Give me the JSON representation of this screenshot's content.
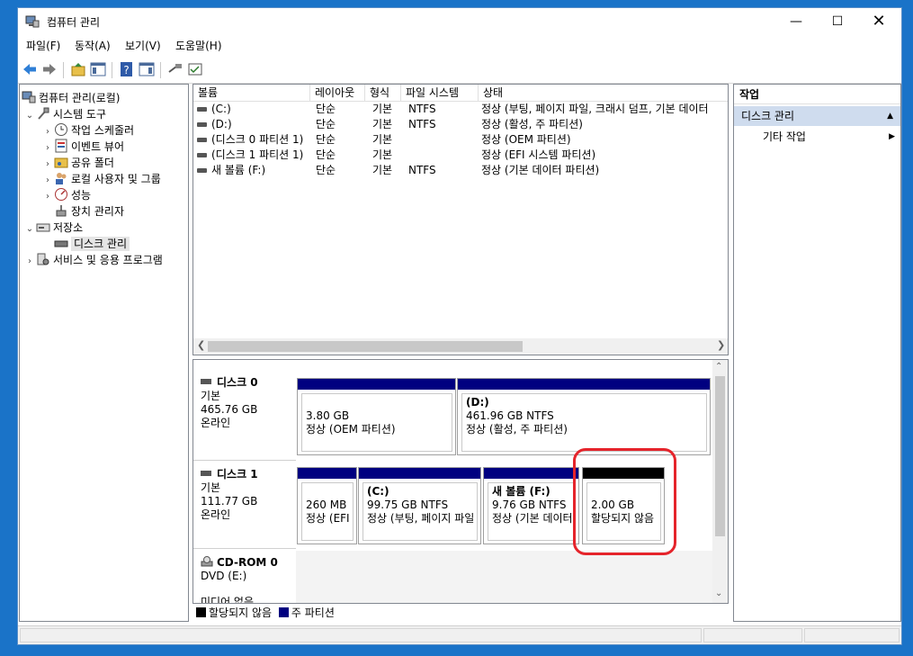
{
  "window": {
    "title": "컴퓨터 관리"
  },
  "menu": [
    "파일(F)",
    "동작(A)",
    "보기(V)",
    "도움말(H)"
  ],
  "tree": {
    "root": "컴퓨터 관리(로컬)",
    "system_tools": "시스템 도구",
    "task_scheduler": "작업 스케줄러",
    "event_viewer": "이벤트 뷰어",
    "shared_folders": "공유 폴더",
    "local_users": "로컬 사용자 및 그룹",
    "performance": "성능",
    "device_manager": "장치 관리자",
    "storage": "저장소",
    "disk_management": "디스크 관리",
    "services": "서비스 및 응용 프로그램"
  },
  "volume_list": {
    "headers": [
      "볼륨",
      "레이아웃",
      "형식",
      "파일 시스템",
      "상태"
    ],
    "rows": [
      [
        "(C:)",
        "단순",
        "기본",
        "NTFS",
        "정상 (부팅, 페이지 파일, 크래시 덤프, 기본 데이터"
      ],
      [
        "(D:)",
        "단순",
        "기본",
        "NTFS",
        "정상 (활성, 주 파티션)"
      ],
      [
        "(디스크 0 파티션 1)",
        "단순",
        "기본",
        "",
        "정상 (OEM 파티션)"
      ],
      [
        "(디스크 1 파티션 1)",
        "단순",
        "기본",
        "",
        "정상 (EFI 시스템 파티션)"
      ],
      [
        "새 볼륨 (F:)",
        "단순",
        "기본",
        "NTFS",
        "정상 (기본 데이터 파티션)"
      ]
    ]
  },
  "disks": {
    "disk0": {
      "name": "디스크 0",
      "type": "기본",
      "size": "465.76 GB",
      "status": "온라인",
      "p1": {
        "size": "3.80 GB",
        "status": "정상 (OEM 파티션)"
      },
      "p2": {
        "label": "(D:)",
        "size": "461.96 GB NTFS",
        "status": "정상 (활성, 주 파티션)"
      }
    },
    "disk1": {
      "name": "디스크 1",
      "type": "기본",
      "size": "111.77 GB",
      "status": "온라인",
      "p1": {
        "size": "260 MB",
        "status": "정상 (EFI"
      },
      "p2": {
        "label": "(C:)",
        "size": "99.75 GB NTFS",
        "status": "정상 (부팅, 페이지 파일"
      },
      "p3": {
        "label": "새 볼륨  (F:)",
        "size": "9.76 GB NTFS",
        "status": "정상 (기본 데이터"
      },
      "p4": {
        "size": "2.00 GB",
        "status": "할당되지 않음"
      }
    },
    "cdrom": {
      "name": "CD-ROM 0",
      "drive": "DVD (E:)",
      "status": "미디어 없음"
    }
  },
  "legend": {
    "unallocated": "할당되지 않음",
    "primary": "주 파티션"
  },
  "actions": {
    "header": "작업",
    "section": "디스크 관리",
    "more": "기타 작업"
  },
  "colors": {
    "primary": "#000080",
    "unallocated": "#000000",
    "highlight": "#e5242b"
  }
}
